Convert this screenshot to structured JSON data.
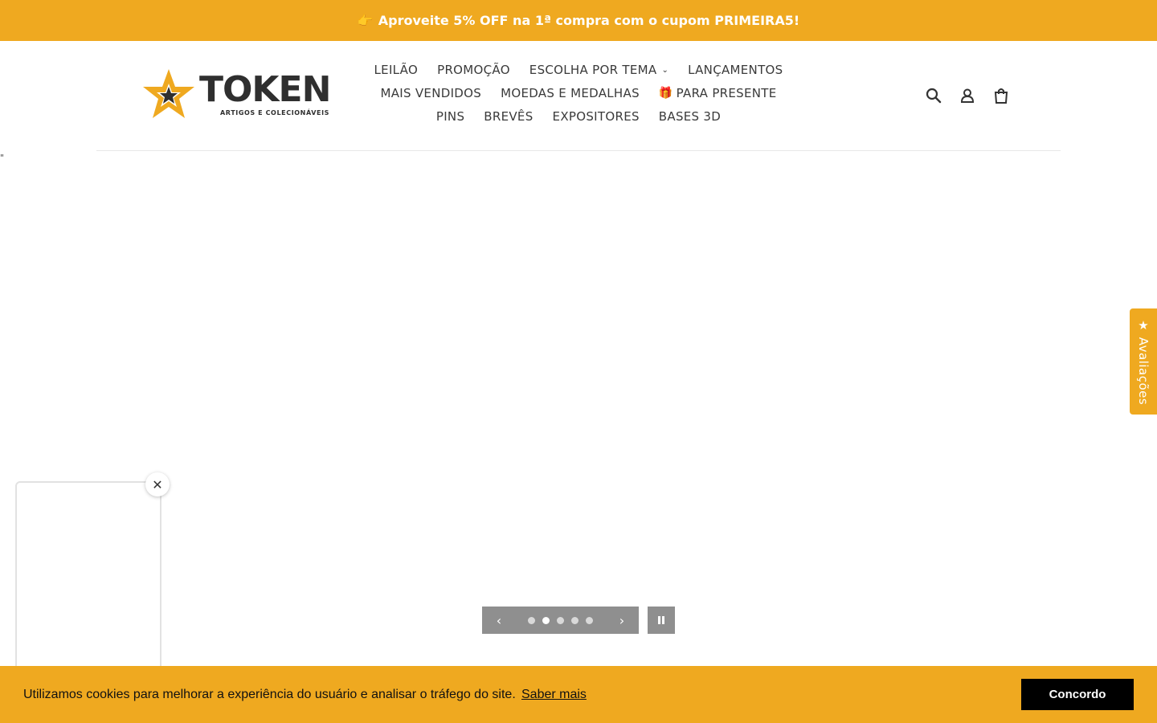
{
  "announcement": {
    "emoji": "👉",
    "text": "Aproveite 5% OFF na 1ª compra com o cupom PRIMEIRA5!"
  },
  "brand": {
    "name": "TOKEN",
    "tagline": "ARTIGOS E COLECIONÁVEIS",
    "accent_color": "#efa920",
    "dark_color": "#2f2f2f"
  },
  "nav": {
    "rows": [
      [
        {
          "label": "LEILÃO"
        },
        {
          "label": "PROMOÇÃO"
        },
        {
          "label": "ESCOLHA POR TEMA",
          "dropdown": true
        },
        {
          "label": "LANÇAMENTOS"
        }
      ],
      [
        {
          "label": "MAIS VENDIDOS"
        },
        {
          "label": "MOEDAS E MEDALHAS"
        },
        {
          "label": "PARA PRESENTE",
          "icon": "🎁"
        }
      ],
      [
        {
          "label": "PINS"
        },
        {
          "label": "BREVÊS"
        },
        {
          "label": "EXPOSITORES"
        },
        {
          "label": "BASES 3D"
        }
      ]
    ]
  },
  "header_icons": [
    "search-icon",
    "account-icon",
    "cart-icon"
  ],
  "stray_text": "\"",
  "slideshow": {
    "slide_count": 5,
    "active_slide": 2,
    "prev_glyph": "‹",
    "next_glyph": "›"
  },
  "reviews_tab": {
    "label": "★ Avaliações"
  },
  "widget": {
    "close_glyph": "✕"
  },
  "cookie": {
    "message": "Utilizamos cookies para melhorar a experiência do usuário e analisar o tráfego do site.",
    "link_label": "Saber mais",
    "accept_label": "Concordo"
  }
}
